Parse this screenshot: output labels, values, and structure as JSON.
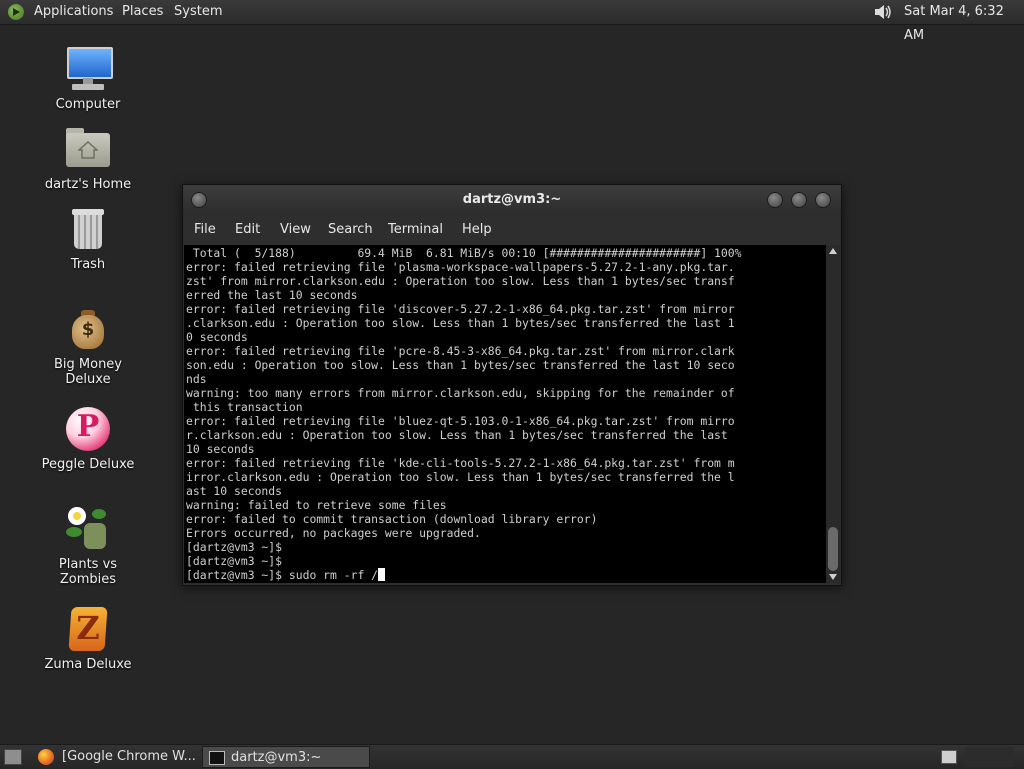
{
  "top_panel": {
    "menus": [
      "Applications",
      "Places",
      "System"
    ],
    "clock": "Sat Mar  4,  6:32 AM"
  },
  "desktop": {
    "icons": [
      {
        "label": "Computer"
      },
      {
        "label": "dartz's Home"
      },
      {
        "label": "Trash"
      },
      {
        "label": "Big Money Deluxe"
      },
      {
        "label": "Peggle Deluxe"
      },
      {
        "label": "Plants vs Zombies"
      },
      {
        "label": "Zuma Deluxe"
      }
    ]
  },
  "terminal": {
    "title": "dartz@vm3:~",
    "menu": [
      "File",
      "Edit",
      "View",
      "Search",
      "Terminal",
      "Help"
    ],
    "lines": [
      " Total (  5/188)         69.4 MiB  6.81 MiB/s 00:10 [######################] 100%",
      "error: failed retrieving file 'plasma-workspace-wallpapers-5.27.2-1-any.pkg.tar.",
      "zst' from mirror.clarkson.edu : Operation too slow. Less than 1 bytes/sec transf",
      "erred the last 10 seconds",
      "error: failed retrieving file 'discover-5.27.2-1-x86_64.pkg.tar.zst' from mirror",
      ".clarkson.edu : Operation too slow. Less than 1 bytes/sec transferred the last 1",
      "0 seconds",
      "error: failed retrieving file 'pcre-8.45-3-x86_64.pkg.tar.zst' from mirror.clark",
      "son.edu : Operation too slow. Less than 1 bytes/sec transferred the last 10 seco",
      "nds",
      "warning: too many errors from mirror.clarkson.edu, skipping for the remainder of",
      " this transaction",
      "error: failed retrieving file 'bluez-qt-5.103.0-1-x86_64.pkg.tar.zst' from mirro",
      "r.clarkson.edu : Operation too slow. Less than 1 bytes/sec transferred the last",
      "10 seconds",
      "error: failed retrieving file 'kde-cli-tools-5.27.2-1-x86_64.pkg.tar.zst' from m",
      "irror.clarkson.edu : Operation too slow. Less than 1 bytes/sec transferred the l",
      "ast 10 seconds",
      "warning: failed to retrieve some files",
      "error: failed to commit transaction (download library error)",
      "Errors occurred, no packages were upgraded.",
      "[dartz@vm3 ~]$",
      "[dartz@vm3 ~]$",
      "[dartz@vm3 ~]$ sudo rm -rf /"
    ]
  },
  "taskbar": {
    "tasks": [
      {
        "label": "[Google Chrome W..."
      },
      {
        "label": "dartz@vm3:~"
      }
    ]
  },
  "colors": {
    "desktop_bg": "#262626",
    "terminal_bg": "#000000",
    "terminal_fg": "#cfcfcf"
  },
  "icons": {
    "logo": "os-logo-icon",
    "volume": "speaker-icon",
    "computer": "computer-icon",
    "home": "home-folder-icon",
    "trash": "trash-icon",
    "big_money": "money-bag-icon",
    "peggle": "peggle-icon",
    "plants": "plants-vs-zombies-icon",
    "zuma": "zuma-icon",
    "firefox": "firefox-icon",
    "terminal": "terminal-icon"
  }
}
